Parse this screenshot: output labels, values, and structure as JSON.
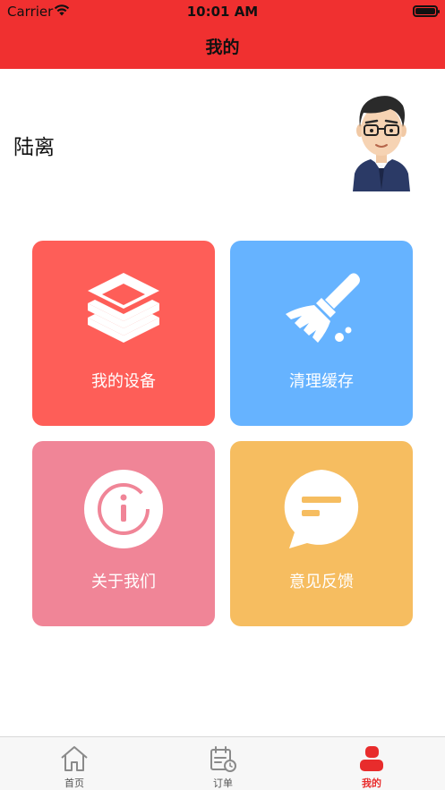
{
  "status_bar": {
    "carrier": "Carrier",
    "time": "10:01 AM",
    "wifi_icon": "wifi-icon",
    "battery_icon": "battery-full-icon"
  },
  "nav": {
    "title": "我的",
    "background_color": "#f03030"
  },
  "profile": {
    "name": "陆离",
    "avatar_icon": "cartoon-man-with-glasses-avatar"
  },
  "menu": [
    {
      "label": "我的设备",
      "icon": "layers-stack-icon",
      "color": "#fe5e58"
    },
    {
      "label": "清理缓存",
      "icon": "broom-icon",
      "color": "#66b3ff"
    },
    {
      "label": "关于我们",
      "icon": "info-circle-icon",
      "color": "#f08597"
    },
    {
      "label": "意见反馈",
      "icon": "chat-bubble-icon",
      "color": "#f6bd60"
    }
  ],
  "tabbar": {
    "items": [
      {
        "label": "首页",
        "icon": "home-icon",
        "active": false
      },
      {
        "label": "订单",
        "icon": "calendar-clock-icon",
        "active": false
      },
      {
        "label": "我的",
        "icon": "person-icon",
        "active": true
      }
    ],
    "active_color": "#e82c2c"
  }
}
